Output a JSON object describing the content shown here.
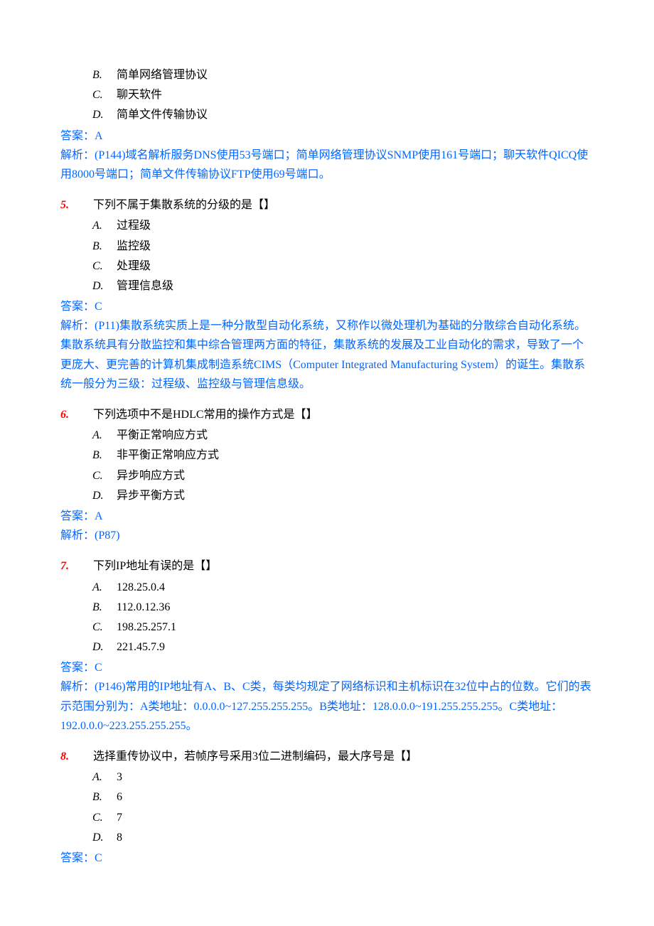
{
  "q4": {
    "options": {
      "b": "简单网络管理协议",
      "c": "聊天软件",
      "d": "简单文件传输协议"
    },
    "answer": "答案：A",
    "explain": "解析：(P144)域名解析服务DNS使用53号端口；简单网络管理协议SNMP使用161号端口；聊天软件QICQ使用8000号端口；简单文件传输协议FTP使用69号端口。"
  },
  "q5": {
    "num": "5.",
    "text": "下列不属于集散系统的分级的是【】",
    "options": {
      "a": "过程级",
      "b": "监控级",
      "c": "处理级",
      "d": "管理信息级"
    },
    "answer": "答案：C",
    "explain": "解析：(P11)集散系统实质上是一种分散型自动化系统，又称作以微处理机为基础的分散综合自动化系统。集散系统具有分散监控和集中综合管理两方面的特征，集散系统的发展及工业自动化的需求，导致了一个更庞大、更完善的计算机集成制造系统CIMS（Computer Integrated Manufacturing System）的诞生。集散系统一般分为三级：过程级、监控级与管理信息级。"
  },
  "q6": {
    "num": "6.",
    "text": "下列选项中不是HDLC常用的操作方式是【】",
    "options": {
      "a": "平衡正常响应方式",
      "b": "非平衡正常响应方式",
      "c": "异步响应方式",
      "d": "异步平衡方式"
    },
    "answer": "答案：A",
    "explain": "解析：(P87)"
  },
  "q7": {
    "num": "7.",
    "text": "下列IP地址有误的是【】",
    "options": {
      "a": "128.25.0.4",
      "b": "112.0.12.36",
      "c": "198.25.257.1",
      "d": "221.45.7.9"
    },
    "answer": "答案：C",
    "explain": "解析：(P146)常用的IP地址有A、B、C类，每类均规定了网络标识和主机标识在32位中占的位数。它们的表示范围分别为：A类地址：0.0.0.0~127.255.255.255。B类地址：128.0.0.0~191.255.255.255。C类地址：192.0.0.0~223.255.255.255。"
  },
  "q8": {
    "num": "8.",
    "text": "选择重传协议中，若帧序号采用3位二进制编码，最大序号是【】",
    "options": {
      "a": "3",
      "b": "6",
      "c": "7",
      "d": "8"
    },
    "answer": "答案：C"
  },
  "letters": {
    "a": "A.",
    "b": "B.",
    "c": "C.",
    "d": "D."
  }
}
